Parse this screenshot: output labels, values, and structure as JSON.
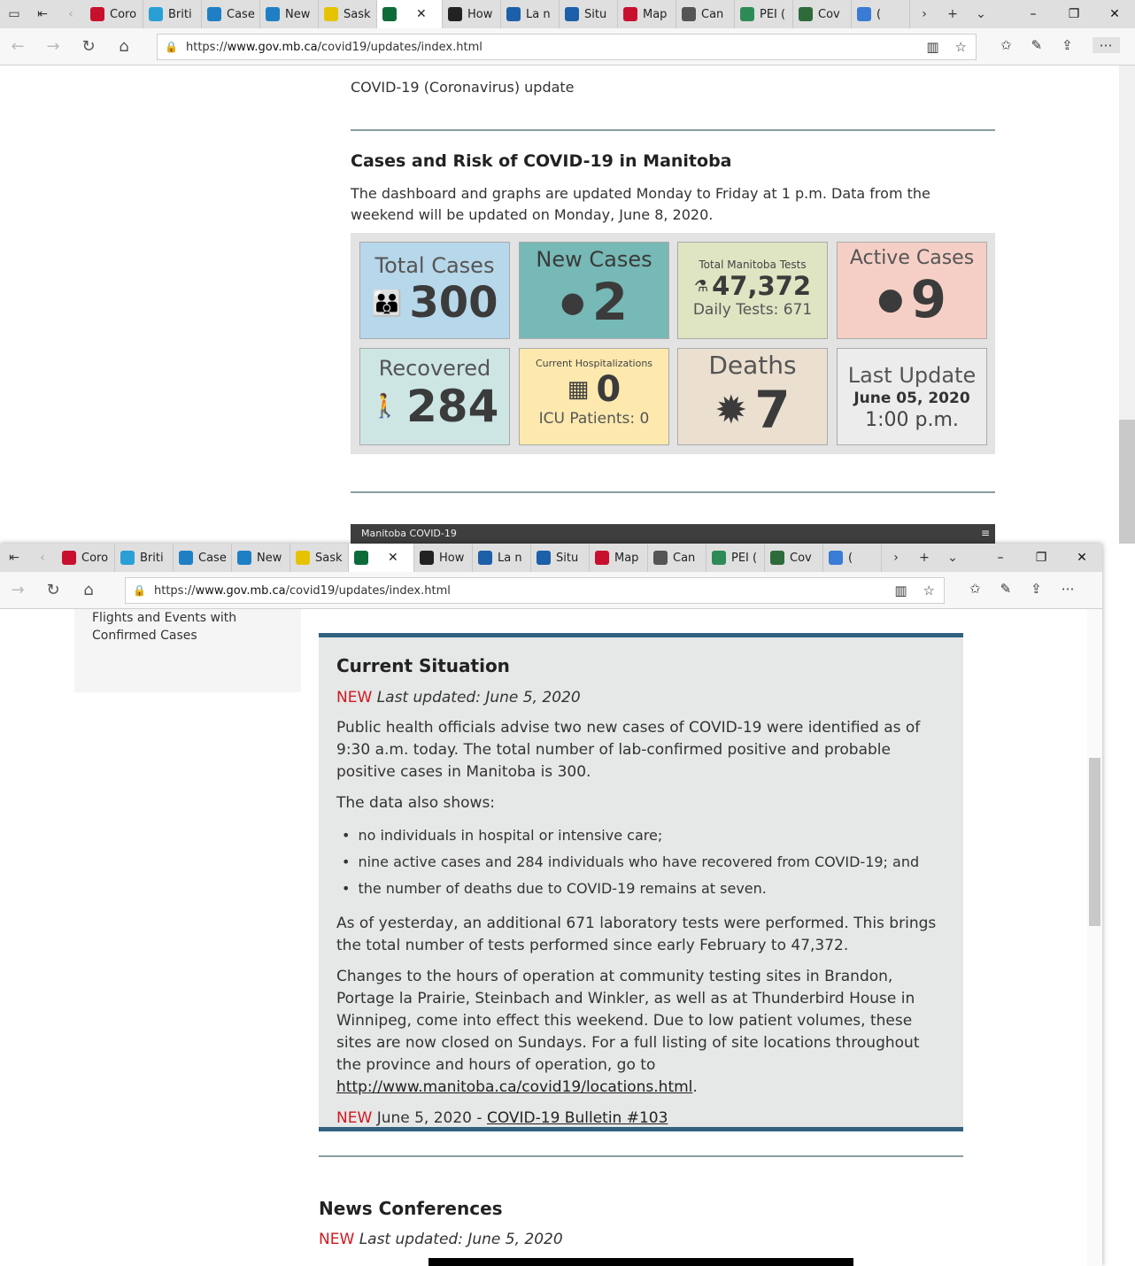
{
  "browser": {
    "tabs": [
      {
        "label": "Coro",
        "color": "#c8102e"
      },
      {
        "label": "Briti",
        "color": "#2a9fd6"
      },
      {
        "label": "Case",
        "color": "#1f7fc4"
      },
      {
        "label": "New",
        "color": "#1f7fc4"
      },
      {
        "label": "Sask",
        "color": "#e6c300"
      },
      {
        "label": "",
        "color": "#0d6b3a",
        "active": true
      },
      {
        "label": "How",
        "color": "#222222"
      },
      {
        "label": "La n",
        "color": "#1d5fa8"
      },
      {
        "label": "Situ",
        "color": "#1d5fa8"
      },
      {
        "label": "Map",
        "color": "#c8102e"
      },
      {
        "label": "Can",
        "color": "#555555"
      },
      {
        "label": "PEI (",
        "color": "#2e8b57"
      },
      {
        "label": "Cov",
        "color": "#2e6b3a"
      },
      {
        "label": "(",
        "color": "#3a7bd5"
      }
    ],
    "url_prefix": "https://",
    "url_host": "www.gov.mb.ca",
    "url_path": "/covid19/updates/index.html"
  },
  "top": {
    "update_heading": "COVID-19 (Coronavirus) update",
    "cases_heading": "Cases and Risk of COVID-19 in Manitoba",
    "cases_intro": "The dashboard and graphs are updated Monday to Friday at 1 p.m. Data from the weekend will be updated on Monday, June 8, 2020.",
    "dashboard": {
      "total_cases_label": "Total Cases",
      "total_cases": "300",
      "new_cases_label": "New Cases",
      "new_cases": "2",
      "tests_label": "Total Manitoba Tests",
      "tests": "47,372",
      "daily_tests": "Daily Tests: 671",
      "active_label": "Active Cases",
      "active": "9",
      "recovered_label": "Recovered",
      "recovered": "284",
      "hosp_label": "Current Hospitalizations",
      "hosp": "0",
      "icu": "ICU Patients: 0",
      "deaths_label": "Deaths",
      "deaths": "7",
      "last_update_label": "Last Update",
      "last_update_date": "June 05, 2020",
      "last_update_time": "1:00 p.m.",
      "colors": {
        "total": "#b7d7ea",
        "new": "#76b9b6",
        "tests": "#dfe4c2",
        "active": "#f5cfc6",
        "recovered": "#cde6e4",
        "hosp": "#fde9ae",
        "deaths": "#ebdfd0",
        "last": "#ececec"
      }
    },
    "embed_bar_title": "Manitoba COVID-19"
  },
  "bottom": {
    "sidebar_link": "Flights and Events with Confirmed Cases",
    "situation": {
      "title": "Current Situation",
      "new_tag": "NEW",
      "last_updated": "Last updated: June 5, 2020",
      "para1": "Public health officials advise two new cases of COVID-19 were identified as of 9:30 a.m. today. The total number of lab-confirmed positive and probable positive cases in Manitoba is 300.",
      "para2": "The data also shows:",
      "bullets": [
        "no individuals in hospital or intensive care;",
        "nine active cases and 284 individuals who have recovered from COVID-19; and",
        "the number of deaths due to COVID-19 remains at seven."
      ],
      "para3": "As of yesterday, an additional 671 laboratory tests were performed. This brings the total number of tests performed since early February to 47,372.",
      "para4": "Changes to the hours of operation at community testing sites in Brandon, Portage la Prairie, Steinbach and Winkler, as well as at Thunderbird House in Winnipeg, come into effect this weekend. Due to low patient volumes, these sites are now closed on Sundays. For a full listing of site locations throughout the province and hours of operation, go to",
      "para4_link": "http://www.manitoba.ca/covid19/locations.html",
      "bulletin_date": "June 5, 2020 - ",
      "bulletin_link": "COVID-19 Bulletin #103"
    },
    "news_heading": "News Conferences",
    "news_updated": "Last updated: June 5, 2020"
  }
}
